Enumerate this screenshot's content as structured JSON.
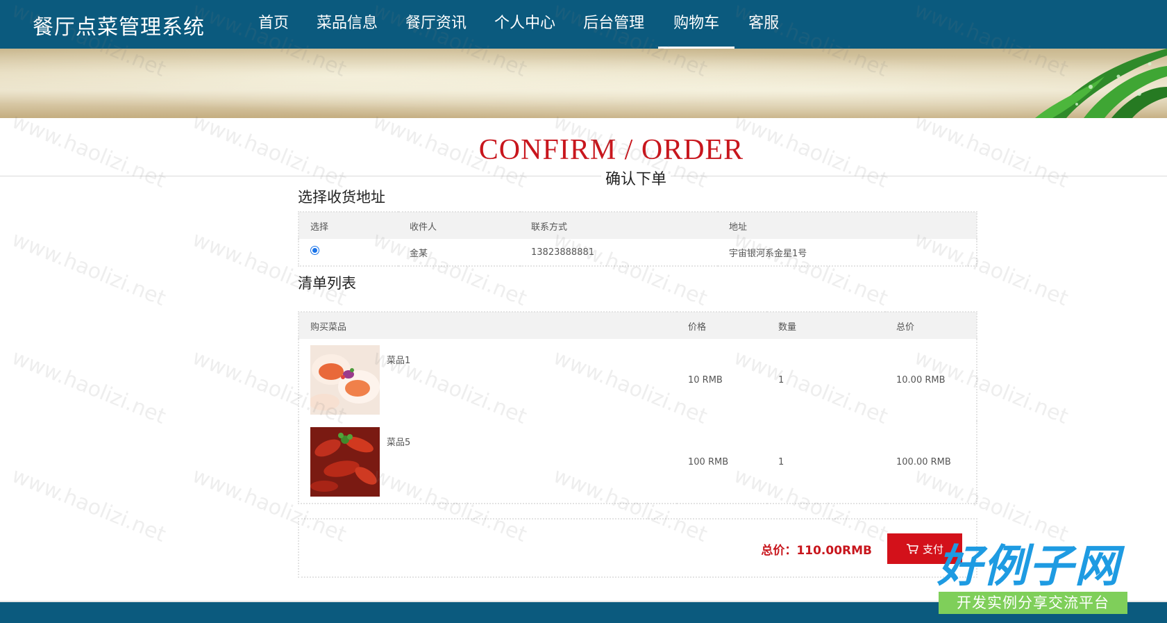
{
  "header": {
    "brand": "餐厅点菜管理系统",
    "nav": [
      {
        "label": "首页",
        "active": false
      },
      {
        "label": "菜品信息",
        "active": false
      },
      {
        "label": "餐厅资讯",
        "active": false
      },
      {
        "label": "个人中心",
        "active": false
      },
      {
        "label": "后台管理",
        "active": false
      },
      {
        "label": "购物车",
        "active": true
      },
      {
        "label": "客服",
        "active": false
      }
    ]
  },
  "page_title": {
    "en": "CONFIRM / ORDER",
    "zh": "确认下单"
  },
  "address": {
    "section_title": "选择收货地址",
    "columns": [
      "选择",
      "收件人",
      "联系方式",
      "地址"
    ],
    "rows": [
      {
        "selected": true,
        "recipient": "金某",
        "phone": "13823888881",
        "address": "宇宙银河系金星1号"
      }
    ]
  },
  "order_list": {
    "section_title": "清单列表",
    "columns": [
      "购买菜品",
      "价格",
      "数量",
      "总价"
    ],
    "rows": [
      {
        "name": "菜品1",
        "price": "10 RMB",
        "qty": "1",
        "subtotal": "10.00 RMB",
        "thumb_icon": "scallop-dish-photo"
      },
      {
        "name": "菜品5",
        "price": "100 RMB",
        "qty": "1",
        "subtotal": "100.00 RMB",
        "thumb_icon": "crayfish-dish-photo"
      }
    ]
  },
  "summary": {
    "total_text": "总价：110.00RMB",
    "pay_label": "支付",
    "pay_icon": "cart-icon"
  },
  "watermark": "www.haolizi.net",
  "logo": {
    "main": "好例子网",
    "sub": "开发实例分享交流平台"
  },
  "colors": {
    "nav_bg": "#0b5a7e",
    "accent_red": "#c8161d",
    "pay_button": "#d3111a",
    "logo_blue": "#1e9be2",
    "logo_green": "#7fcf5a"
  }
}
